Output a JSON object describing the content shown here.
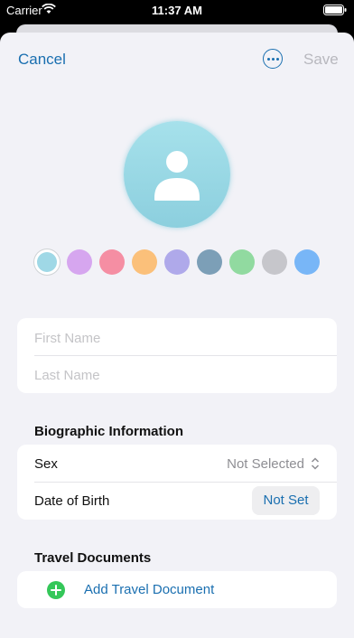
{
  "status_bar": {
    "carrier": "Carrier",
    "time": "11:37 AM"
  },
  "nav": {
    "cancel_label": "Cancel",
    "more_icon": "ellipsis-circle-icon",
    "save_label": "Save"
  },
  "avatar": {
    "icon": "person-icon",
    "color": "#9fd8e6"
  },
  "color_swatches": [
    {
      "color": "#9fd8e6",
      "selected": true
    },
    {
      "color": "#d6a6ef"
    },
    {
      "color": "#f58ea3"
    },
    {
      "color": "#fbc07a"
    },
    {
      "color": "#afa9ea"
    },
    {
      "color": "#7c9fb7"
    },
    {
      "color": "#91daa0"
    },
    {
      "color": "#c6c6cb"
    },
    {
      "color": "#78b6f7"
    }
  ],
  "name_fields": {
    "first_name_placeholder": "First Name",
    "last_name_placeholder": "Last Name"
  },
  "biographic": {
    "header": "Biographic Information",
    "sex_label": "Sex",
    "sex_value": "Not Selected",
    "dob_label": "Date of Birth",
    "dob_value": "Not Set"
  },
  "travel_documents": {
    "header": "Travel Documents",
    "add_label": "Add Travel Document",
    "add_icon": "plus-circle-icon"
  },
  "colors": {
    "accent": "#1a6fb0",
    "add_green": "#34c759"
  }
}
